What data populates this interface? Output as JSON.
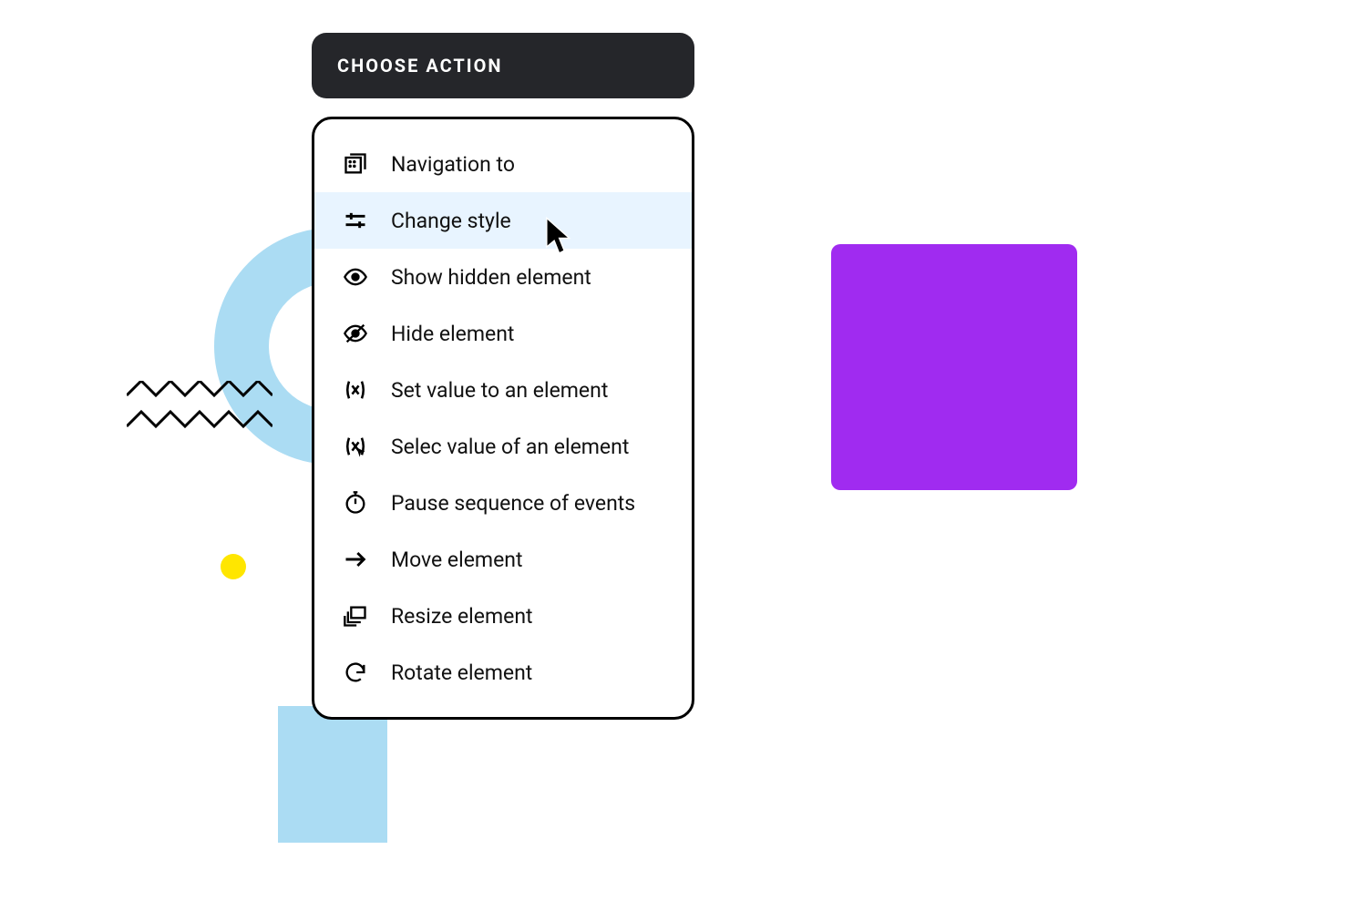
{
  "header": {
    "title": "CHOOSE ACTION"
  },
  "menu": {
    "hovered_index": 1,
    "items": [
      {
        "id": "navigation",
        "label": "Navigation to",
        "icon": "navigation-icon"
      },
      {
        "id": "change-style",
        "label": "Change style",
        "icon": "sliders-icon"
      },
      {
        "id": "show-hidden",
        "label": "Show hidden element",
        "icon": "eye-icon"
      },
      {
        "id": "hide-element",
        "label": "Hide element",
        "icon": "eye-off-icon"
      },
      {
        "id": "set-value",
        "label": "Set value to an element",
        "icon": "variable-x-icon"
      },
      {
        "id": "select-value",
        "label": "Selec value of an element",
        "icon": "variable-select-icon"
      },
      {
        "id": "pause",
        "label": "Pause sequence of events",
        "icon": "stopwatch-icon"
      },
      {
        "id": "move",
        "label": "Move element",
        "icon": "arrow-right-icon"
      },
      {
        "id": "resize",
        "label": "Resize element",
        "icon": "resize-icon"
      },
      {
        "id": "rotate",
        "label": "Rotate element",
        "icon": "rotate-icon"
      }
    ]
  },
  "colors": {
    "header_bg": "#25262a",
    "hover_bg": "#e8f4ff",
    "ring": "#abdcf3",
    "dot": "#ffe600",
    "purple": "#a02bf0"
  }
}
